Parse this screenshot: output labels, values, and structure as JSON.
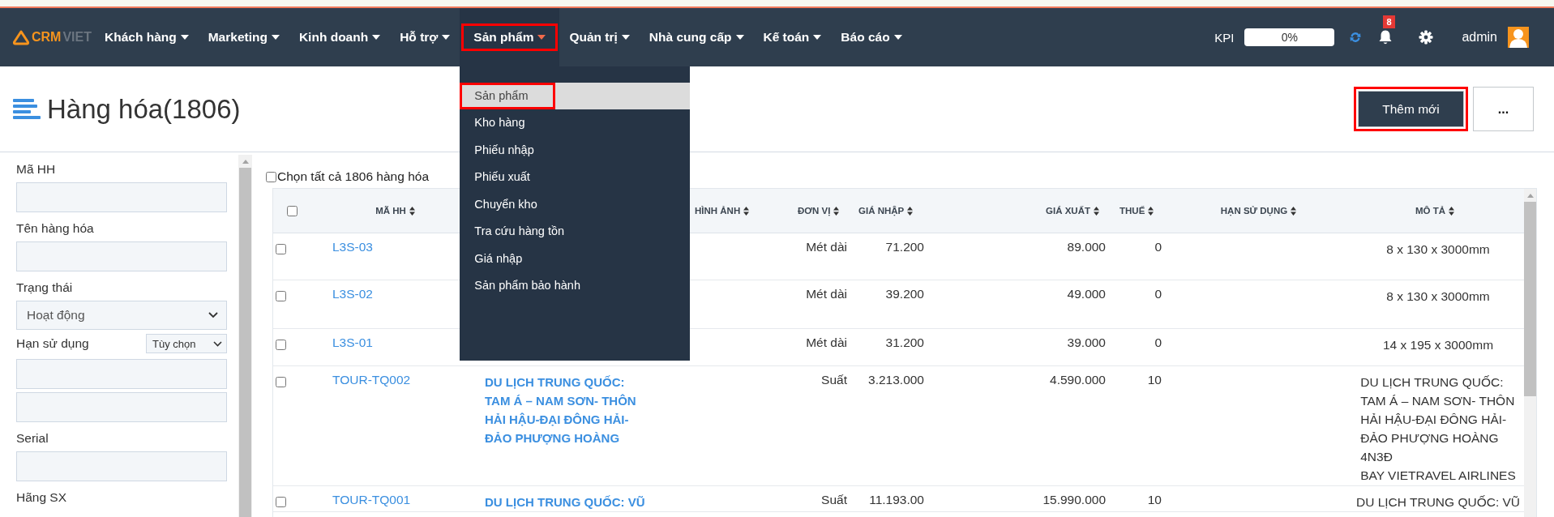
{
  "navbar": {
    "logo": {
      "brand_1": "CRM",
      "brand_2": "VIET"
    },
    "menu": [
      {
        "label": "Khách hàng",
        "selected": false
      },
      {
        "label": "Marketing",
        "selected": false
      },
      {
        "label": "Kinh doanh",
        "selected": false
      },
      {
        "label": "Hỗ trợ",
        "selected": false
      },
      {
        "label": "Sản phẩm",
        "selected": true
      },
      {
        "label": "Quản trị",
        "selected": false
      },
      {
        "label": "Nhà cung cấp",
        "selected": false
      },
      {
        "label": "Kế toán",
        "selected": false
      },
      {
        "label": "Báo cáo",
        "selected": false
      }
    ],
    "kpi": {
      "label": "KPI",
      "reading": "0%",
      "level": 0
    },
    "notification_badge": "8",
    "user": {
      "name": "admin"
    }
  },
  "menu_dropdown": [
    {
      "label": "Sản phẩm",
      "selected": true
    },
    {
      "label": "Kho hàng",
      "selected": false
    },
    {
      "label": "Phiếu nhập",
      "selected": false
    },
    {
      "label": "Phiếu xuất",
      "selected": false
    },
    {
      "label": "Chuyển kho",
      "selected": false
    },
    {
      "label": "Tra cứu hàng tồn",
      "selected": false
    },
    {
      "label": "Giá nhập",
      "selected": false
    },
    {
      "label": "Sản phẩm bảo hành",
      "selected": false
    }
  ],
  "page_header": {
    "title": "Hàng hóa(1806)",
    "buttons": [
      {
        "kind": "primary",
        "label": "Thêm mới",
        "marked": true
      },
      {
        "kind": "more",
        "label": "...",
        "marked": false
      }
    ]
  },
  "filters": [
    {
      "kind": "text",
      "label": "Mã HH"
    },
    {
      "kind": "text",
      "label": "Tên hàng hóa"
    },
    {
      "kind": "select",
      "label": "Trạng thái",
      "value": "Hoạt động"
    },
    {
      "kind": "range",
      "label": "Hạn sử dụng",
      "option": "Tùy chọn"
    },
    {
      "kind": "text",
      "label": "Serial"
    },
    {
      "kind": "label",
      "label": "Hãng SX"
    }
  ],
  "select_all": {
    "label": "Chọn tất cả 1806 hàng hóa",
    "checked": false
  },
  "table": {
    "header_checked": false,
    "columns": [
      {
        "label": "MÃ HH"
      },
      {
        "label": "HÌNH ẢNH"
      },
      {
        "label": "ĐƠN VỊ"
      },
      {
        "label": "GIÁ NHẬP"
      },
      {
        "label": "GIÁ XUẤT"
      },
      {
        "label": "THUẾ"
      },
      {
        "label": "HẠN SỬ DỤNG"
      },
      {
        "label": "MÔ TẢ"
      }
    ],
    "rows": [
      {
        "checked": false,
        "code": "L3S-03",
        "unit": "Mét dài",
        "import_price": "71.200",
        "export_price": "89.000",
        "tax": "0",
        "description": "8 x 130 x 3000mm"
      },
      {
        "checked": false,
        "code": "L3S-02",
        "unit": "Mét dài",
        "import_price": "39.200",
        "export_price": "49.000",
        "tax": "0",
        "description": "8 x 130 x 3000mm"
      },
      {
        "checked": false,
        "code": "L3S-01",
        "unit": "Mét dài",
        "import_price": "31.200",
        "export_price": "39.000",
        "tax": "0",
        "description": "14 x 195 x 3000mm"
      },
      {
        "checked": false,
        "code": "TOUR-TQ002",
        "name": "DU LỊCH TRUNG QUỐC:\nTAM Á – NAM SƠN- THÔN\nHẢI HẬU-ĐẠI ĐÔNG HẢI-\nĐẢO PHƯỢNG HOÀNG",
        "unit": "Suất",
        "import_price": "3.213.000",
        "export_price": "4.590.000",
        "tax": "10",
        "description": "DU LỊCH TRUNG QUỐC:\nTAM Á – NAM SƠN- THÔN\nHẢI HẬU-ĐẠI ĐÔNG HẢI-\nĐẢO PHƯỢNG HOÀNG\n4N3Đ\nBAY VIETRAVEL AIRLINES"
      },
      {
        "checked": false,
        "code": "TOUR-TQ001",
        "name": "DU LỊCH TRUNG QUỐC: VŨ",
        "unit": "Suất",
        "import_price": "11.193.00",
        "export_price": "15.990.000",
        "tax": "10",
        "description": "DU LỊCH TRUNG QUỐC: VŨ"
      }
    ]
  }
}
